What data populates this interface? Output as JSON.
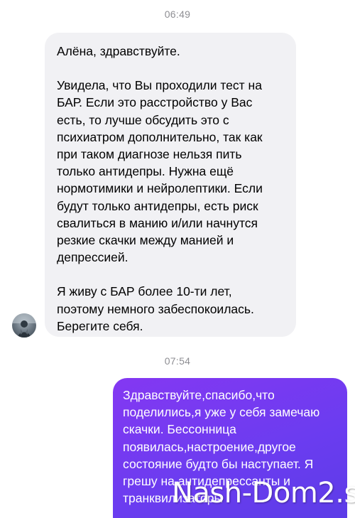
{
  "chat": {
    "timestamp_1": "06:49",
    "timestamp_2": "07:54",
    "incoming_message": {
      "greeting": "Алёна, здравствуйте.",
      "paragraph_1": "Увидела, что Вы проходили тест на\nБАР. Если это расстройство у Вас\nесть, то лучше обсудить это с\nпсихиатром дополнительно, так как\nпри таком диагнозе нельзя пить\nтолько антидепры. Нужна ещё\nнормотимики и нейролептики. Если\nбудут только антидепры, есть риск\nсвалиться в манию и/или начнутся\nрезкие скачки между манией и\nдепрессией.",
      "paragraph_2": "Я живу с БАР более 10-ти лет,\nпоэтому немного забеспокоилась.\nБерегите себя."
    },
    "outgoing_message": {
      "text": "Здравствуйте,спасибо,что\nподелились,я уже у себя замечаю\nскачки. Бессонница\nпоявилась,настроение,другое\nсостояние будто бы наступает. Я\nгрешу на антидепрессанты и\nтранквилизаторы"
    },
    "avatar_icon": "user-avatar-photo",
    "colors": {
      "incoming_bubble": "#f1f1f4",
      "outgoing_bubble": "#6b3cf0",
      "timestamp": "#8e8e93"
    }
  },
  "watermark": "Nash-Dom2.su"
}
